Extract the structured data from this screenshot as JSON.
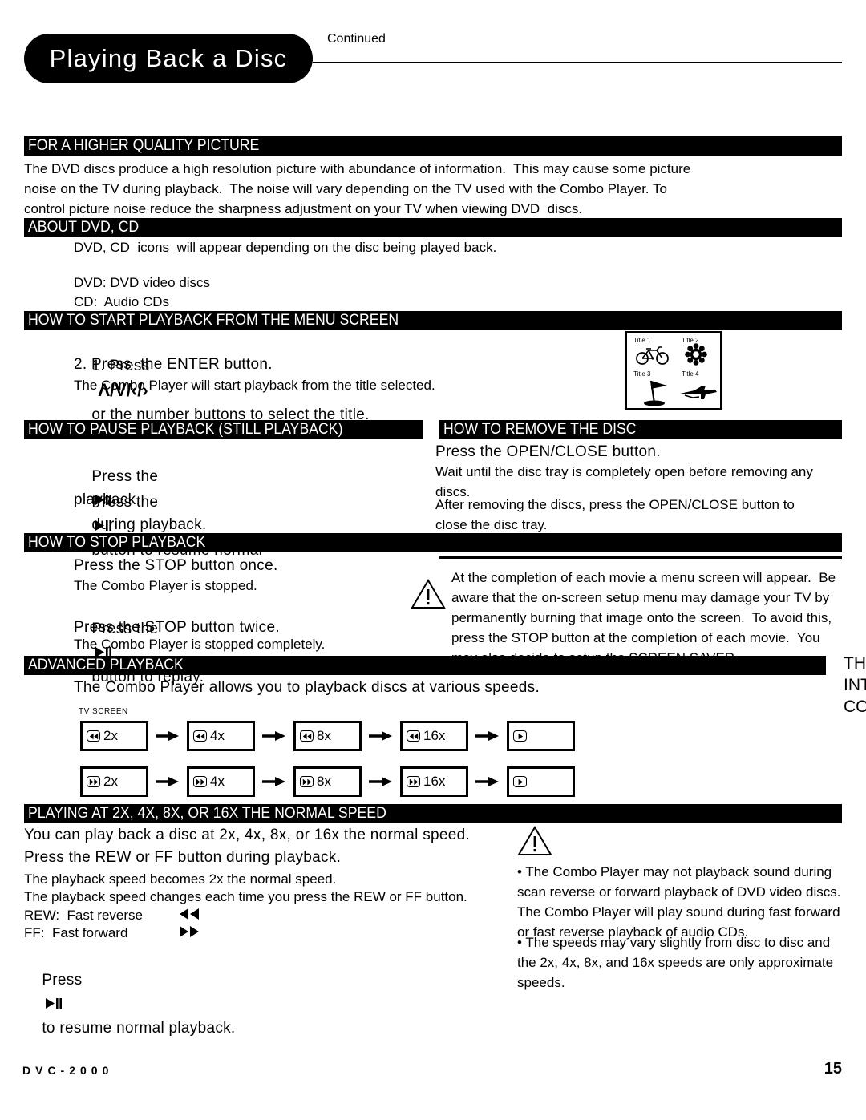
{
  "header": {
    "title": "Playing Back a Disc",
    "continued": "Continued"
  },
  "sections": {
    "higher_quality": {
      "bar": "FOR A HIGHER QUALITY PICTURE",
      "body": "The DVD discs produce a high resolution picture with abundance of information.  This may cause some picture\nnoise on the TV during playback.  The noise will vary depending on the TV used with the Combo Player. To\ncontrol picture noise reduce the sharpness adjustment on your TV when viewing DVD  discs."
    },
    "about": {
      "bar": "ABOUT DVD, CD",
      "body": "DVD, CD  icons  will appear depending on the disc being played back.",
      "line_dvd": "DVD: DVD video discs",
      "line_cd": "CD:  Audio CDs"
    },
    "menu_screen": {
      "bar": "HOW TO START PLAYBACK FROM THE MENU SCREEN",
      "step1_pre": "1. Press",
      "step1_keys": "Λ/V/‹/›",
      "step1_post": "or the number buttons to select the title.",
      "step2": "2. Press  the ENTER button.",
      "note": "The Combo Player will start playback from the title selected."
    },
    "pause": {
      "bar": "HOW TO PAUSE PLAYBACK (STILL PLAYBACK)",
      "line1_pre": "Press the",
      "line1_post": "during playback.",
      "line2_pre": "Press the",
      "line2_post": "button to resume normal",
      "line3": "playback."
    },
    "remove": {
      "bar": "HOW TO REMOVE THE DISC",
      "line1": "Press the OPEN/CLOSE button.",
      "body1": "Wait until the disc tray is completely open before removing any\ndiscs.",
      "body2": "After removing the discs, press the OPEN/CLOSE button to\nclose the disc tray."
    },
    "stop": {
      "bar": "HOW TO STOP PLAYBACK",
      "line1": "Press the STOP button once.",
      "line2": "The Combo Player is stopped.",
      "line3_pre": "Press the",
      "line3_post": "button to replay.",
      "line4": "Press the STOP button twice.",
      "line5": "The Combo Player is stopped completely."
    },
    "caution_menu": {
      "body": "At the completion of each movie a menu screen will appear.  Be\naware that the on-screen setup menu may damage your TV by\npermanently burning that image onto the screen.  To avoid this,\npress the STOP button at the completion of each movie.  You\nmay also decide to setup the SCREEN SAVER."
    },
    "advanced": {
      "bar": "ADVANCED PLAYBACK",
      "body": "The Combo Player allows you to playback discs at various speeds."
    },
    "speeds": {
      "bar": "PLAYING AT 2X, 4X, 8X, OR 16X THE NORMAL SPEED",
      "line1": "You can play back a disc at 2x, 4x, 8x, or 16x the normal speed.",
      "line2": "Press the REW or FF button during playback.",
      "line3": "The playback speed becomes 2x the normal speed.",
      "line4": "The playback speed changes each time you press the REW or FF button.",
      "rew_label": "REW:  Fast reverse",
      "ff_label": "FF:  Fast forward",
      "resume_pre": "Press",
      "resume_post": "to resume normal playback."
    },
    "caution_speeds": {
      "bullet1": "• The Combo Player may not playback sound during\nscan reverse or forward playback of DVD video discs.\nThe Combo Player will play sound during fast forward\nor fast reverse playback of audio CDs.",
      "bullet2": "• The speeds may vary slightly from disc to disc and\nthe 2x, 4x, 8x, and 16x speeds are only approximate\nspeeds."
    }
  },
  "tv_menu": {
    "titles": [
      "Title 1",
      "Title 2",
      "Title 3",
      "Title 4"
    ]
  },
  "flow_diagram": {
    "tv_screen_label": "TV SCREEN",
    "rewind_row": [
      "2x",
      "4x",
      "8x",
      "16x",
      ""
    ],
    "forward_row": [
      "2x",
      "4x",
      "8x",
      "16x",
      ""
    ]
  },
  "clipped_right": {
    "line1": "TH",
    "line2": "INT",
    "line3": "CO"
  },
  "footer": {
    "model": "DVC-2000",
    "page": "15"
  }
}
